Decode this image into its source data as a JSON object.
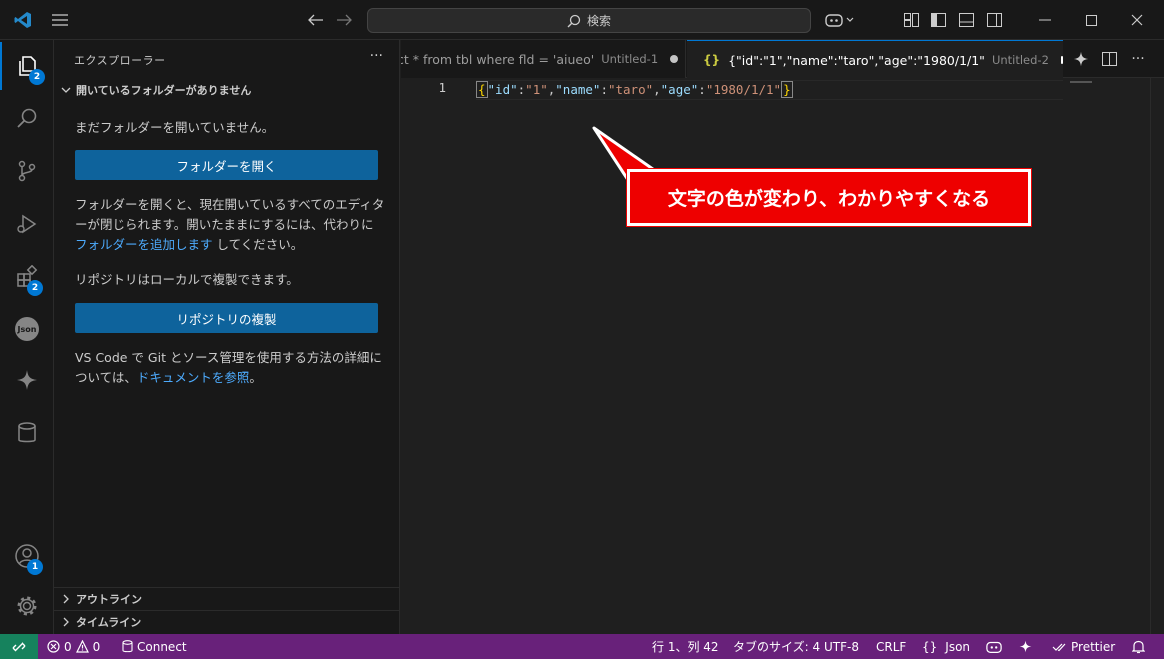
{
  "titlebar": {
    "search_text": "検索"
  },
  "activity": {
    "explorer_badge": "2",
    "extensions_badge": "2",
    "accounts_badge": "1",
    "json_label": "Json"
  },
  "sidebar": {
    "title": "エクスプローラー",
    "more": "···",
    "section_no_folder": "開いているフォルダーがありません",
    "no_folder_text": "まだフォルダーを開いていません。",
    "open_folder_button": "フォルダーを開く",
    "info_text_1": "フォルダーを開くと、現在開いているすべてのエディターが閉じられます。開いたままにするには、代わりに ",
    "info_link": "フォルダーを追加します",
    "info_text_2": " してください。",
    "repo_text": "リポジトリはローカルで複製できます。",
    "clone_button": "リポジトリの複製",
    "git_text": "VS Code で Git とソース管理を使用する方法の詳細については、",
    "git_link": "ドキュメントを参照",
    "git_text_end": "。",
    "outline_label": "アウトライン",
    "timeline_label": "タイムライン"
  },
  "tabs": [
    {
      "label": "ct * from tbl where fld = 'aiueo'",
      "description": "Untitled-1"
    },
    {
      "icon": "{}",
      "label": "{\"id\":\"1\",\"name\":\"taro\",\"age\":\"1980/1/1\"",
      "description": "Untitled-2"
    }
  ],
  "editor": {
    "line_number": "1",
    "tokens": {
      "open": "{",
      "k1": "\"id\"",
      "c1": ":",
      "v1": "\"1\"",
      "s1": ",",
      "k2": "\"name\"",
      "c2": ":",
      "v2": "\"taro\"",
      "s2": ",",
      "k3": "\"age\"",
      "c3": ":",
      "v3": "\"1980/1/1\"",
      "close": "}"
    }
  },
  "callout": {
    "text": "文字の色が変わり、わかりやすくなる"
  },
  "statusbar": {
    "errors": "0",
    "warnings": "0",
    "connect": "Connect",
    "position": "行 1、列 42",
    "tab_size": "タブのサイズ: 4",
    "encoding": "UTF-8",
    "eol": "CRLF",
    "language_icon": "{}",
    "language": "Json",
    "prettier": "Prettier"
  },
  "colors": {
    "accent": "#0078d4",
    "statusbar": "#68217a",
    "remote": "#16825d",
    "callout": "#ee0000"
  }
}
